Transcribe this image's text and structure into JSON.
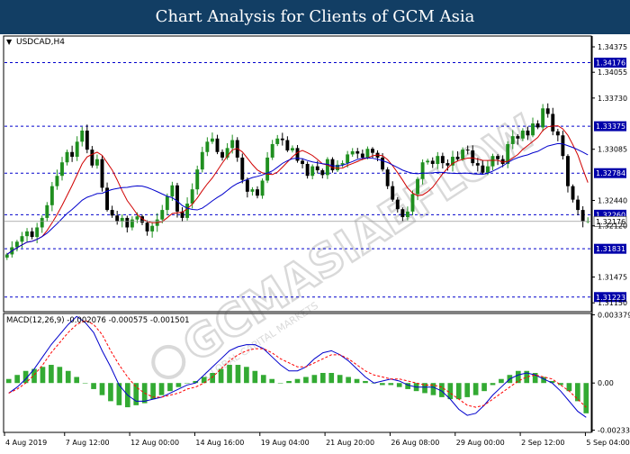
{
  "header": {
    "title": "Chart Analysis for Clients of GCM Asia"
  },
  "watermark": {
    "brand_text": "GCMASIAEFLOW",
    "tagline": "GLOBAL CAPITAL MARKETS"
  },
  "chart_data": [
    {
      "type": "candlestick",
      "title": "USDCAD,H4",
      "instrument": "USDCAD",
      "timeframe": "H4",
      "ylim": [
        1.3105,
        1.345
      ],
      "y_tick_labels": [
        "1.34375",
        "1.34055",
        "1.33730",
        "1.33085",
        "1.32440",
        "1.32120",
        "1.31475",
        "1.31150"
      ],
      "y_ticks": [
        1.34375,
        1.34055,
        1.3373,
        1.33085,
        1.3244,
        1.3212,
        1.31475,
        1.3115
      ],
      "levels": [
        {
          "label": "1.34176",
          "value": 1.34176,
          "style": "dashed",
          "color": "#0000cc"
        },
        {
          "label": "1.33375",
          "value": 1.33375,
          "style": "dashed",
          "color": "#0000cc"
        },
        {
          "label": "1.32784",
          "value": 1.32784,
          "style": "dashed",
          "color": "#0000cc"
        },
        {
          "label": "1.32260",
          "value": 1.3226,
          "style": "dashed",
          "color": "#0000cc"
        },
        {
          "label": "1.31831",
          "value": 1.31831,
          "style": "dashed",
          "color": "#0000cc"
        },
        {
          "label": "1.31223",
          "value": 1.31223,
          "style": "dashed",
          "color": "#0000cc"
        }
      ],
      "current_price": {
        "label": "1.32176",
        "value": 1.32176
      },
      "x_tick_labels": [
        "4 Aug 2019",
        "7 Aug 12:00",
        "12 Aug 00:00",
        "14 Aug 16:00",
        "19 Aug 04:00",
        "21 Aug 20:00",
        "26 Aug 08:00",
        "29 Aug 00:00",
        "2 Sep 12:00",
        "5 Sep 04:00"
      ],
      "x_tick_index": [
        0,
        12,
        25,
        38,
        51,
        64,
        77,
        90,
        103,
        116
      ],
      "close": [
        1.3176,
        1.3185,
        1.3192,
        1.3199,
        1.3205,
        1.3198,
        1.321,
        1.3222,
        1.3238,
        1.3262,
        1.3275,
        1.3292,
        1.3305,
        1.3299,
        1.3318,
        1.3332,
        1.3308,
        1.3288,
        1.3296,
        1.326,
        1.3232,
        1.3225,
        1.3218,
        1.3222,
        1.321,
        1.322,
        1.3224,
        1.3216,
        1.3205,
        1.3212,
        1.322,
        1.3232,
        1.3249,
        1.3263,
        1.323,
        1.3222,
        1.324,
        1.3258,
        1.3283,
        1.3305,
        1.3318,
        1.3322,
        1.3305,
        1.3298,
        1.331,
        1.332,
        1.3298,
        1.327,
        1.3255,
        1.3258,
        1.325,
        1.3269,
        1.3298,
        1.3315,
        1.3322,
        1.332,
        1.3307,
        1.331,
        1.3294,
        1.329,
        1.3275,
        1.3287,
        1.3282,
        1.3276,
        1.3296,
        1.3282,
        1.3289,
        1.3291,
        1.3302,
        1.3306,
        1.3303,
        1.3298,
        1.3309,
        1.3304,
        1.3298,
        1.3283,
        1.3262,
        1.3245,
        1.3233,
        1.3223,
        1.323,
        1.3252,
        1.3271,
        1.3292,
        1.3294,
        1.329,
        1.33,
        1.3291,
        1.3288,
        1.3299,
        1.3296,
        1.3308,
        1.3307,
        1.3291,
        1.3288,
        1.3279,
        1.3287,
        1.33,
        1.3296,
        1.329,
        1.3315,
        1.3325,
        1.3322,
        1.3332,
        1.3326,
        1.3341,
        1.3336,
        1.336,
        1.3353,
        1.3331,
        1.3326,
        1.33,
        1.3262,
        1.3245,
        1.3232,
        1.3218,
        1.3218
      ]
    },
    {
      "type": "macd",
      "title": "MACD(12,26,9) -0.002076 -0.000575 -0.001501",
      "params": "MACD(12,26,9)",
      "values_text": [
        "-0.002076",
        "-0.000575",
        "-0.001501"
      ],
      "ylim": [
        -0.0024,
        0.0034
      ],
      "y_tick_labels": [
        "0.003379",
        "0.00",
        "-0.002335"
      ],
      "y_ticks": [
        0.003379,
        0.0,
        -0.002335
      ],
      "series": [
        {
          "key": "main",
          "color": "#0000cc",
          "style": "solid",
          "values": [
            -0.0005,
            -0.0002,
            0.0002,
            0.0007,
            0.0013,
            0.0019,
            0.0024,
            0.0029,
            0.0033,
            0.003,
            0.0025,
            0.0016,
            0.0008,
            -0.0001,
            -0.0006,
            -0.0009,
            -0.0009,
            -0.0008,
            -0.0007,
            -0.0005,
            -0.0003,
            -0.0001,
            0.0,
            0.0004,
            0.0008,
            0.0012,
            0.0016,
            0.0018,
            0.0019,
            0.0019,
            0.0017,
            0.0013,
            0.0009,
            0.0006,
            0.0006,
            0.0008,
            0.0012,
            0.0015,
            0.0016,
            0.0014,
            0.0011,
            0.0007,
            0.0003,
            0.0,
            0.0001,
            0.0002,
            0.0001,
            -0.0001,
            -0.0002,
            -0.0002,
            -0.0002,
            -0.0004,
            -0.0008,
            -0.0013,
            -0.0016,
            -0.0015,
            -0.0011,
            -0.0006,
            -0.0002,
            0.0002,
            0.0004,
            0.0005,
            0.0004,
            0.0002,
            0.0,
            -0.0004,
            -0.0009,
            -0.0014,
            -0.0017
          ]
        },
        {
          "key": "signal",
          "color": "#ff0000",
          "style": "dashed",
          "values": [
            -0.0005,
            -0.0003,
            0.0,
            0.0004,
            0.0009,
            0.0015,
            0.002,
            0.0025,
            0.0029,
            0.0031,
            0.0029,
            0.0024,
            0.0016,
            0.0009,
            0.0003,
            -0.0002,
            -0.0005,
            -0.0007,
            -0.0007,
            -0.0006,
            -0.0005,
            -0.0003,
            -0.0002,
            0.0,
            0.0003,
            0.0007,
            0.0011,
            0.0014,
            0.0016,
            0.0017,
            0.0017,
            0.0015,
            0.0012,
            0.001,
            0.0008,
            0.0008,
            0.001,
            0.0012,
            0.0014,
            0.0014,
            0.0012,
            0.0009,
            0.0006,
            0.0004,
            0.0003,
            0.0002,
            0.0002,
            0.0001,
            0.0,
            -0.0001,
            -0.0001,
            -0.0002,
            -0.0005,
            -0.0008,
            -0.0011,
            -0.0012,
            -0.0011,
            -0.0008,
            -0.0005,
            -0.0002,
            0.0001,
            0.0003,
            0.0004,
            0.0003,
            0.0002,
            -0.0001,
            -0.0004,
            -0.0008,
            -0.0012
          ]
        },
        {
          "key": "histogram",
          "color": "#33aa33",
          "style": "bar",
          "values": [
            0.0002,
            0.0004,
            0.0006,
            0.0007,
            0.0008,
            0.0009,
            0.0008,
            0.0006,
            0.0003,
            0.0,
            -0.0003,
            -0.0006,
            -0.0009,
            -0.0011,
            -0.0012,
            -0.0011,
            -0.001,
            -0.0008,
            -0.0006,
            -0.0004,
            -0.0002,
            0.0,
            0.0001,
            0.0003,
            0.0005,
            0.0007,
            0.0009,
            0.0009,
            0.0008,
            0.0006,
            0.0004,
            0.0002,
            0.0,
            0.0001,
            0.0002,
            0.0003,
            0.0004,
            0.0005,
            0.0005,
            0.0004,
            0.0003,
            0.0002,
            0.0001,
            0.0,
            -0.0001,
            -0.0001,
            -0.0002,
            -0.0003,
            -0.0004,
            -0.0005,
            -0.0006,
            -0.0007,
            -0.0008,
            -0.0008,
            -0.0007,
            -0.0006,
            -0.0004,
            -0.0001,
            0.0002,
            0.0004,
            0.0006,
            0.0006,
            0.0005,
            0.0003,
            0.0001,
            -0.0001,
            -0.0004,
            -0.0009,
            -0.0015
          ]
        }
      ]
    }
  ]
}
